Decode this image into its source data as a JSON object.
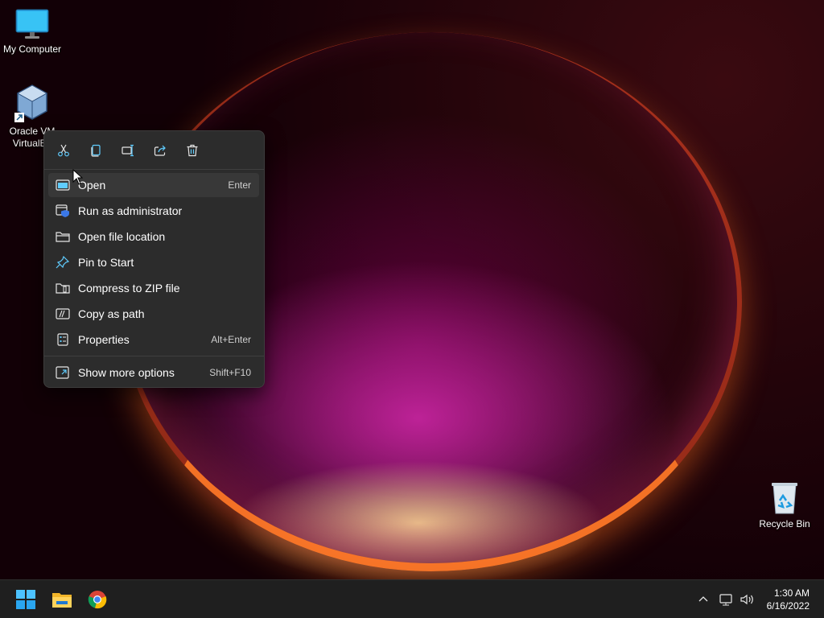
{
  "desktop": {
    "icons": [
      {
        "label": "My Computer"
      },
      {
        "label_line1": "Oracle VM",
        "label_line2": "VirtualBo"
      },
      {
        "label": "Recycle Bin"
      }
    ]
  },
  "context_menu": {
    "toolbar": [
      "cut-icon",
      "copy-icon",
      "rename-icon",
      "share-icon",
      "delete-icon"
    ],
    "items": [
      {
        "label": "Open",
        "shortcut": "Enter"
      },
      {
        "label": "Run as administrator",
        "shortcut": ""
      },
      {
        "label": "Open file location",
        "shortcut": ""
      },
      {
        "label": "Pin to Start",
        "shortcut": ""
      },
      {
        "label": "Compress to ZIP file",
        "shortcut": ""
      },
      {
        "label": "Copy as path",
        "shortcut": ""
      },
      {
        "label": "Properties",
        "shortcut": "Alt+Enter"
      },
      {
        "label": "Show more options",
        "shortcut": "Shift+F10"
      }
    ]
  },
  "taskbar": {
    "apps": [
      "start-icon",
      "file-explorer-icon",
      "chrome-icon"
    ],
    "clock": {
      "time": "1:30 AM",
      "date": "6/16/2022"
    }
  },
  "colors": {
    "accent": "#4cc2ff",
    "menu_bg": "#2c2c2c",
    "taskbar_bg": "#1f1f1f"
  }
}
